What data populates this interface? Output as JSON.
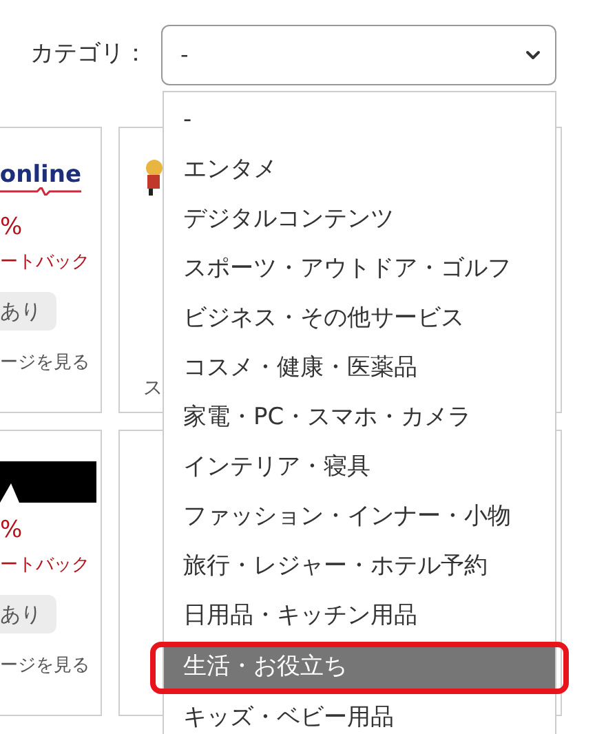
{
  "filter": {
    "label": "カテゴリ：",
    "value": "-"
  },
  "dropdown": {
    "options": [
      {
        "label": "-",
        "selected": false,
        "annotated": false
      },
      {
        "label": "エンタメ",
        "selected": false,
        "annotated": false
      },
      {
        "label": "デジタルコンテンツ",
        "selected": false,
        "annotated": false
      },
      {
        "label": "スポーツ・アウトドア・ゴルフ",
        "selected": false,
        "annotated": false
      },
      {
        "label": "ビジネス・その他サービス",
        "selected": false,
        "annotated": false
      },
      {
        "label": "コスメ・健康・医薬品",
        "selected": false,
        "annotated": false
      },
      {
        "label": "家電・PC・スマホ・カメラ",
        "selected": false,
        "annotated": false
      },
      {
        "label": "インテリア・寝具",
        "selected": false,
        "annotated": false
      },
      {
        "label": "ファッション・インナー・小物",
        "selected": false,
        "annotated": false
      },
      {
        "label": "旅行・レジャー・ホテル予約",
        "selected": false,
        "annotated": false
      },
      {
        "label": "日用品・キッチン用品",
        "selected": false,
        "annotated": false
      },
      {
        "label": "生活・お役立ち",
        "selected": true,
        "annotated": true
      },
      {
        "label": "キッズ・ベビー用品",
        "selected": false,
        "annotated": false
      }
    ]
  },
  "cards": [
    {
      "left": {
        "logo": {
          "kind": "wordmark",
          "text": "online"
        },
        "rate": "%",
        "cashback": "ートバック",
        "badge": "あり",
        "link": "ージを見る"
      },
      "right": {
        "logo": {
          "kind": "figure"
        },
        "link": "ス"
      }
    },
    {
      "left": {
        "logo": {
          "kind": "dark"
        },
        "rate": "%",
        "cashback": "ートバック",
        "badge": "あり",
        "link": "ージを見る"
      }
    }
  ]
}
